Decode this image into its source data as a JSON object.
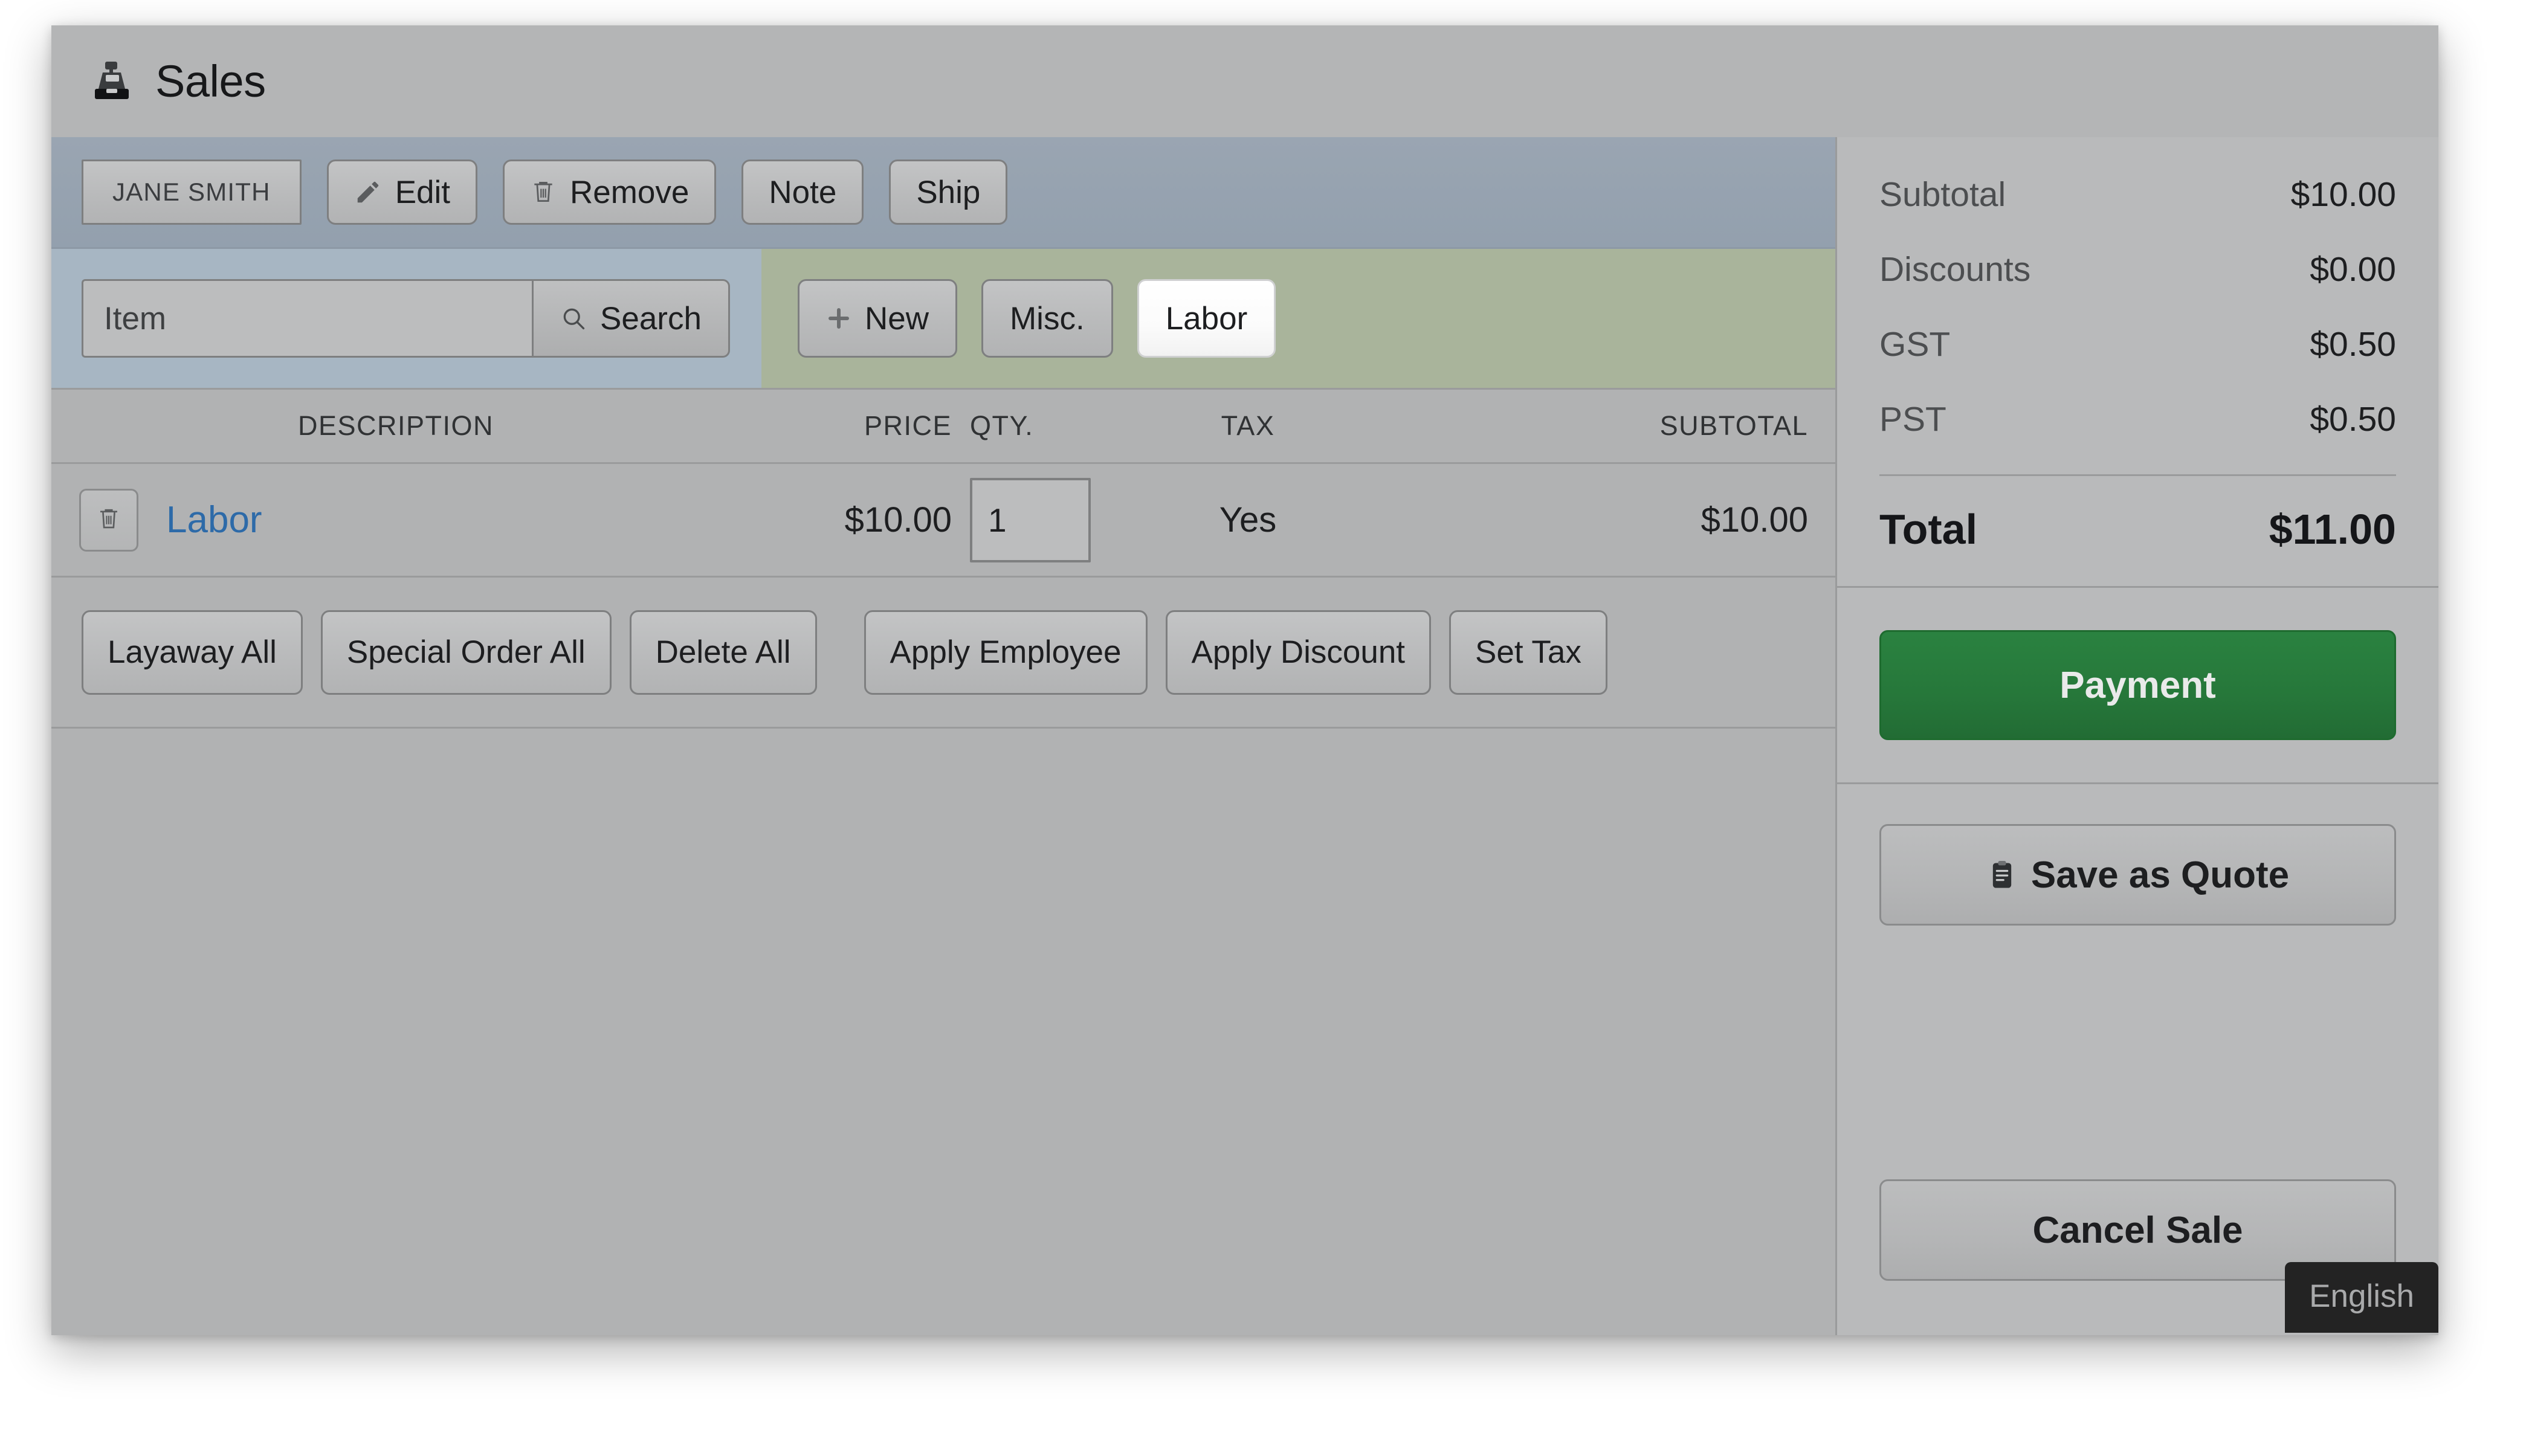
{
  "header": {
    "title": "Sales",
    "icon": "cash-register-icon"
  },
  "toolbar": {
    "customer_name": "JANE SMITH",
    "edit_label": "Edit",
    "edit_icon": "pencil-icon",
    "remove_label": "Remove",
    "remove_icon": "trash-icon",
    "note_label": "Note",
    "ship_label": "Ship"
  },
  "search": {
    "placeholder": "Item",
    "value": "",
    "search_label": "Search",
    "search_icon": "magnifier-icon",
    "new_label": "New",
    "new_icon": "plus-icon",
    "misc_label": "Misc.",
    "labor_label": "Labor",
    "active_tab": "Labor"
  },
  "table": {
    "columns": [
      "DESCRIPTION",
      "PRICE",
      "QTY.",
      "TAX",
      "SUBTOTAL"
    ],
    "rows": [
      {
        "delete_icon": "trash-icon",
        "description": "Labor",
        "price": "$10.00",
        "qty": "1",
        "tax": "Yes",
        "subtotal": "$10.00"
      }
    ]
  },
  "actions": {
    "layaway_all": "Layaway All",
    "special_order_all": "Special Order All",
    "delete_all": "Delete All",
    "apply_employee": "Apply Employee",
    "apply_discount": "Apply Discount",
    "set_tax": "Set Tax"
  },
  "totals": {
    "rows": [
      {
        "label": "Subtotal",
        "value": "$10.00"
      },
      {
        "label": "Discounts",
        "value": "$0.00"
      },
      {
        "label": "GST",
        "value": "$0.50"
      },
      {
        "label": "PST",
        "value": "$0.50"
      }
    ],
    "grand_label": "Total",
    "grand_value": "$11.00"
  },
  "sidebar": {
    "payment_label": "Payment",
    "save_quote_label": "Save as Quote",
    "save_quote_icon": "clipboard-icon",
    "cancel_sale_label": "Cancel Sale"
  },
  "language_badge": {
    "label": "English"
  },
  "colors": {
    "payment_green": "#26773a",
    "item_link_blue": "#2d6aa8",
    "toolbar_bluegray": "#93a0ae",
    "search_left_bluegray": "#a7b6c3",
    "search_right_sage": "#a9b49b",
    "badge_dark": "#232323"
  }
}
